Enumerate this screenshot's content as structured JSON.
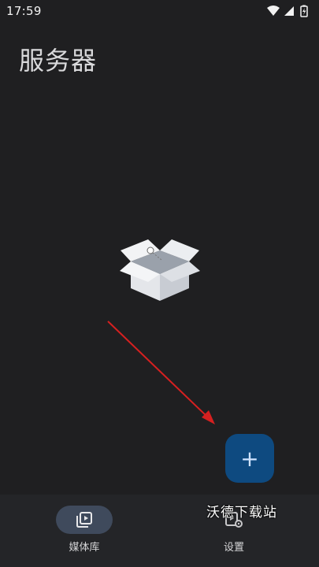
{
  "status_bar": {
    "time": "17:59",
    "icons": [
      "wifi-icon",
      "signal-icon",
      "battery-icon"
    ]
  },
  "page": {
    "title": "服务器"
  },
  "empty_state": {
    "illustration": "open-box-icon"
  },
  "fab": {
    "icon": "plus-icon",
    "label": "+",
    "color": "#0e4a80"
  },
  "bottom_nav": {
    "items": [
      {
        "label": "媒体库",
        "icon": "media-library-icon",
        "active": true
      },
      {
        "label": "设置",
        "icon": "settings-icon",
        "active": false
      }
    ]
  },
  "watermark": {
    "text": "沃德下载站"
  },
  "colors": {
    "background": "#1f1f21",
    "nav_background": "#242528",
    "active_pill": "#3f4a5c",
    "arrow": "#d62020"
  }
}
